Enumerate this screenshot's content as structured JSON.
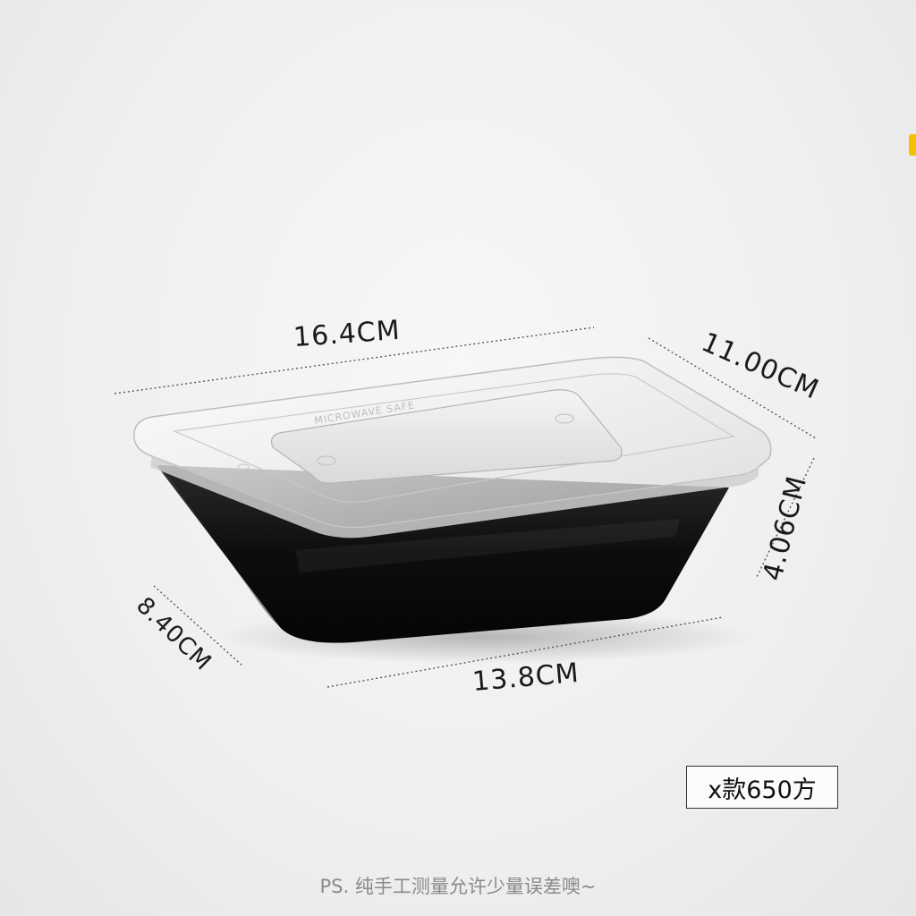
{
  "dimensions": {
    "top_length": "16.4CM",
    "top_width": "11.00CM",
    "height": "4.06CM",
    "bottom_width": "8.40CM",
    "bottom_length": "13.8CM"
  },
  "model_label": "x款650方",
  "lid_emboss_text": "MICROWAVE SAFE",
  "footnote": "PS. 纯手工测量允许少量误差噢~"
}
